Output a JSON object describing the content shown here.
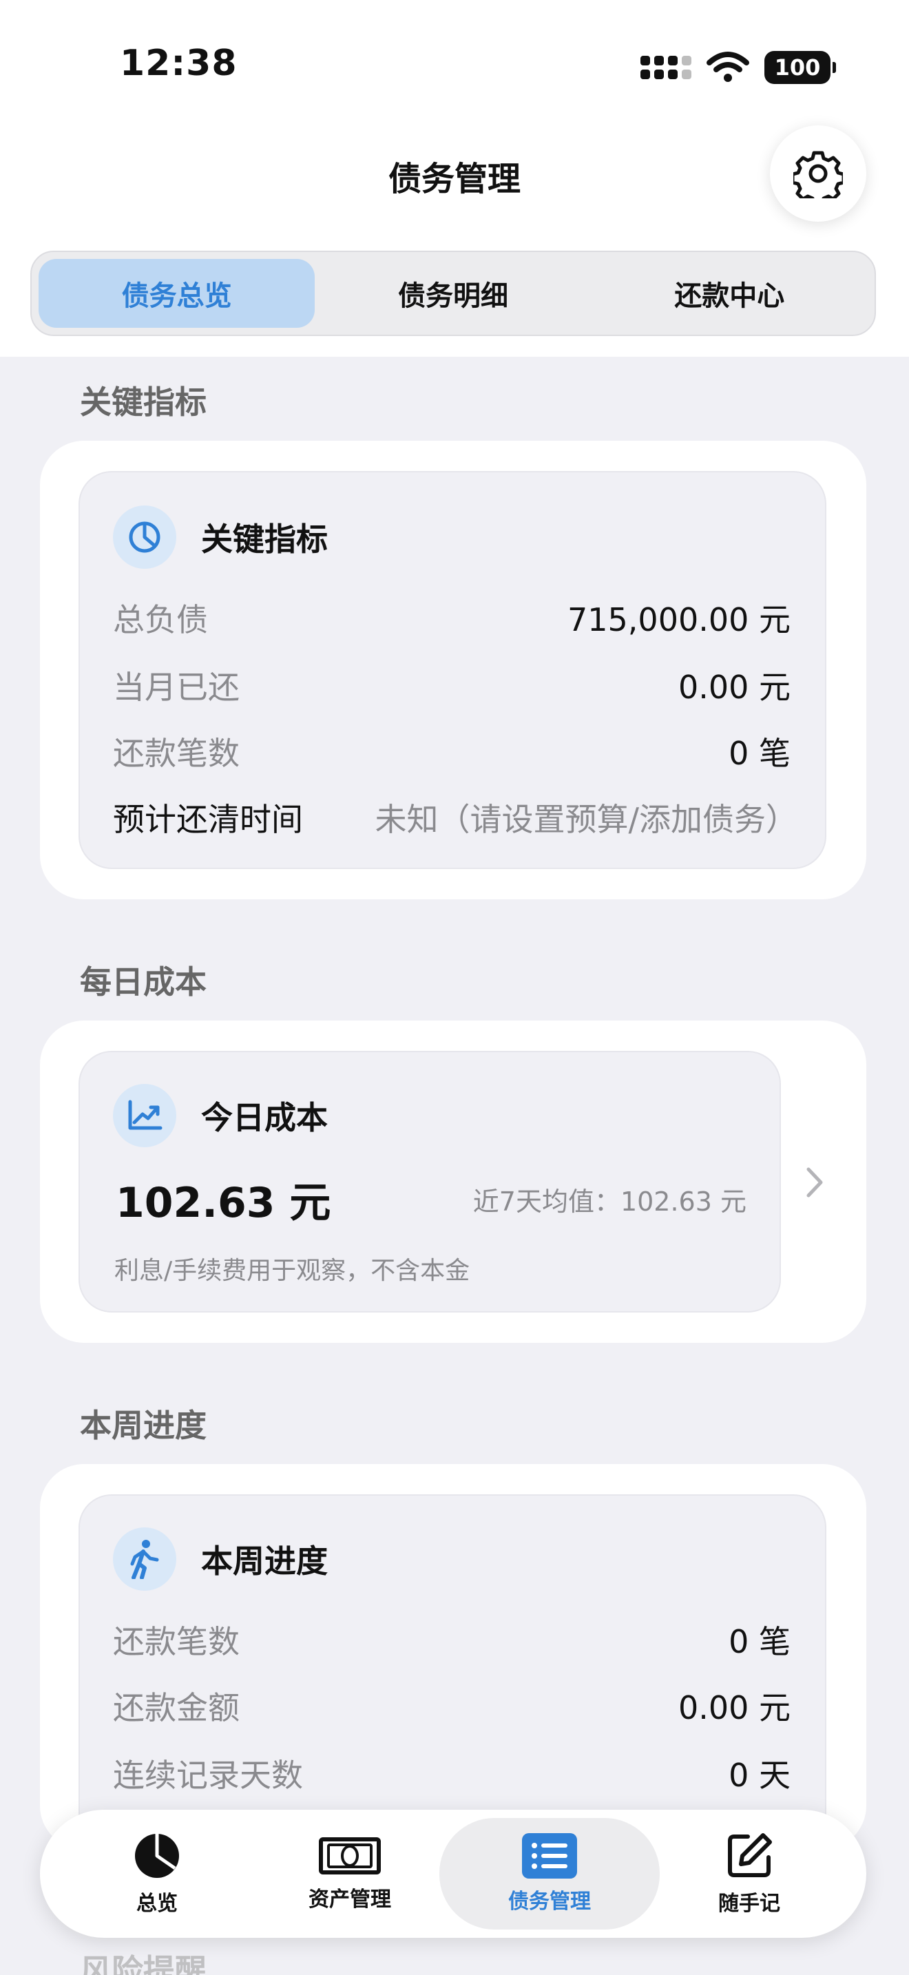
{
  "status_bar": {
    "time": "12:38",
    "battery": "100"
  },
  "header": {
    "title": "债务管理",
    "settings_icon": "gear-icon"
  },
  "segments": [
    {
      "label": "债务总览",
      "active": true
    },
    {
      "label": "债务明细",
      "active": false
    },
    {
      "label": "还款中心",
      "active": false
    }
  ],
  "key_metrics": {
    "section_label": "关键指标",
    "title": "关键指标",
    "icon": "pie-chart-icon",
    "rows": [
      {
        "label": "总负债",
        "value": "715,000.00 元"
      },
      {
        "label": "当月已还",
        "value": "0.00 元"
      },
      {
        "label": "还款笔数",
        "value": "0 笔"
      },
      {
        "label": "预计还清时间",
        "value": "未知（请设置预算/添加债务）"
      }
    ]
  },
  "daily_cost": {
    "section_label": "每日成本",
    "title": "今日成本",
    "icon": "trend-up-icon",
    "amount": "102.63 元",
    "avg_label": "近7天均值：102.63 元",
    "note": "利息/手续费用于观察，不含本金"
  },
  "weekly_progress": {
    "section_label": "本周进度",
    "title": "本周进度",
    "icon": "walking-icon",
    "rows": [
      {
        "label": "还款笔数",
        "value": "0 笔"
      },
      {
        "label": "还款金额",
        "value": "0.00 元"
      },
      {
        "label": "连续记录天数",
        "value": "0 天"
      }
    ]
  },
  "next_section_peek": "风险提醒",
  "tabbar": [
    {
      "label": "总览",
      "icon": "pie-icon",
      "active": false
    },
    {
      "label": "资产管理",
      "icon": "banknote-icon",
      "active": false
    },
    {
      "label": "债务管理",
      "icon": "list-icon",
      "active": true
    },
    {
      "label": "随手记",
      "icon": "edit-icon",
      "active": false
    }
  ],
  "colors": {
    "accent": "#2f80d6",
    "accent_bg": "#bcd7f3",
    "background": "#f0f0f5"
  }
}
